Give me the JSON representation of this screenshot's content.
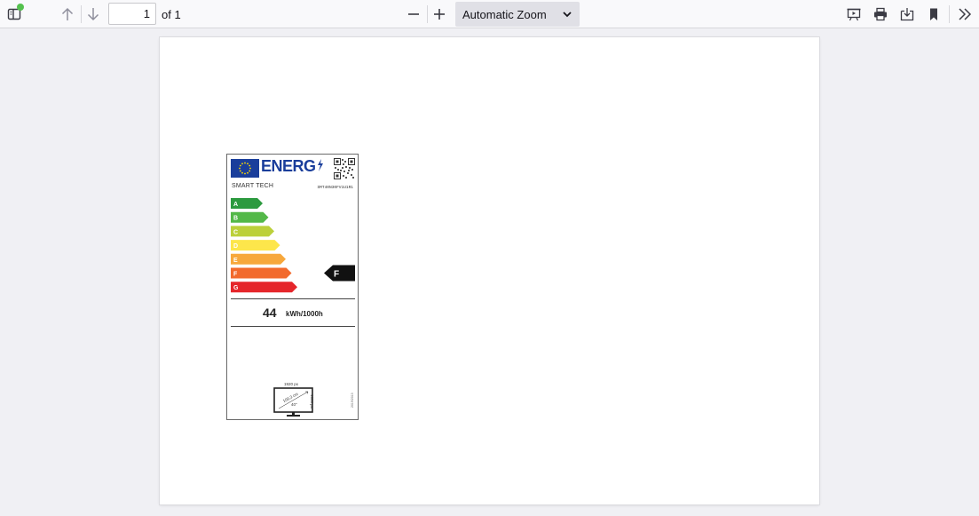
{
  "toolbar": {
    "page_input_value": "1",
    "page_count_label": "of 1",
    "zoom_value": "Automatic Zoom",
    "icons": [
      "sidebar-toggle-icon",
      "previous-page-icon",
      "next-page-icon",
      "zoom-out-icon",
      "zoom-in-icon",
      "presentation-mode-icon",
      "print-icon",
      "save-icon",
      "bookmark-icon",
      "tools-icon"
    ],
    "notification_dot_color": "#54c14e"
  },
  "energy_label": {
    "header_text": "ENERG",
    "brand": "SMART TECH",
    "model": "SMT40N30FV1U1R1",
    "classes": [
      "A",
      "B",
      "C",
      "D",
      "E",
      "F",
      "G"
    ],
    "class_colors": [
      "#2c9a3f",
      "#53b848",
      "#bcd03a",
      "#fde64b",
      "#f7a83c",
      "#f26a2d",
      "#e5262b"
    ],
    "rating": "F",
    "energy_value": "44",
    "energy_unit": "kWh/1000h",
    "resolution_h": "1920 px",
    "resolution_v": "1080 px",
    "diagonal_cm": "100,3 cm",
    "diagonal_in": "40\"",
    "label_code": "2019/2013"
  }
}
